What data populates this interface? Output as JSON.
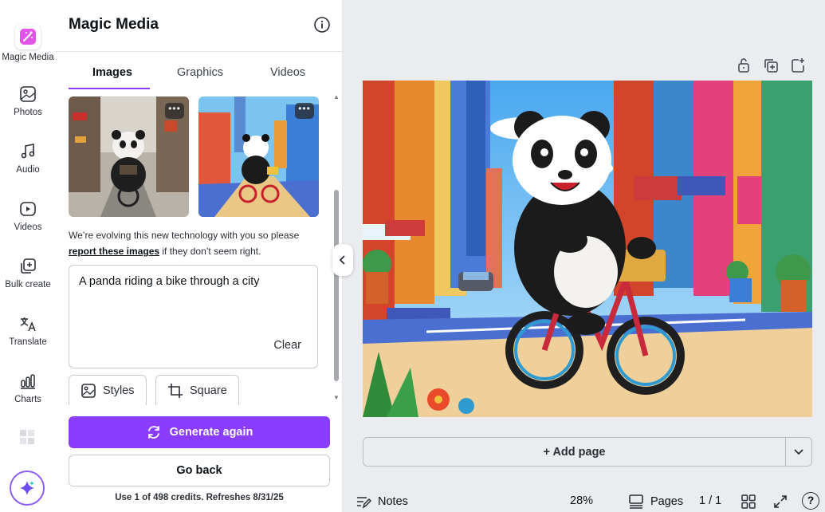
{
  "sidebar": {
    "items": [
      {
        "label": "Magic Media",
        "icon": "magic-media-icon"
      },
      {
        "label": "Photos",
        "icon": "photos-icon"
      },
      {
        "label": "Audio",
        "icon": "audio-icon"
      },
      {
        "label": "Videos",
        "icon": "videos-icon"
      },
      {
        "label": "Bulk create",
        "icon": "bulk-create-icon"
      },
      {
        "label": "Translate",
        "icon": "translate-icon"
      },
      {
        "label": "Charts",
        "icon": "charts-icon"
      }
    ]
  },
  "panel": {
    "title": "Magic Media",
    "tabs": [
      {
        "label": "Images",
        "active": true
      },
      {
        "label": "Graphics",
        "active": false
      },
      {
        "label": "Videos",
        "active": false
      }
    ],
    "notice_prefix": "We’re evolving this new technology with you so please",
    "notice_link": "report these images",
    "notice_suffix": " if they don’t seem right.",
    "prompt": "A panda riding a bike through a city",
    "clear_label": "Clear",
    "style_chip": "Styles",
    "ratio_chip": "Square",
    "generate_label": "Generate again",
    "back_label": "Go back",
    "credits": "Use 1 of 498 credits. Refreshes 8/31/25"
  },
  "canvas": {
    "add_page_label": "+ Add page"
  },
  "footer": {
    "notes": "Notes",
    "zoom": "28%",
    "pages": "Pages",
    "page_count": "1 / 1",
    "help": "?"
  },
  "colors": {
    "accent": "#8b3dff",
    "magic_icon": "#e254e8"
  }
}
